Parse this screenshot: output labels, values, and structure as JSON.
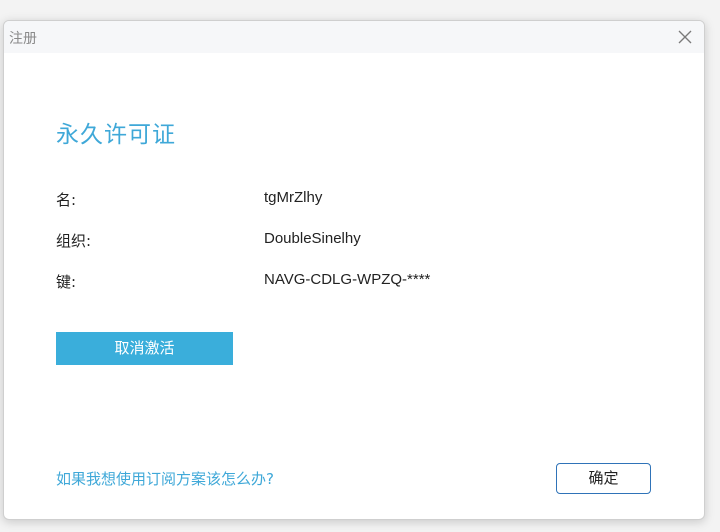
{
  "window": {
    "title": "注册",
    "close_icon": "close-icon"
  },
  "license": {
    "heading": "永久许可证",
    "fields": [
      {
        "label": "名:",
        "value": "tgMrZlhy"
      },
      {
        "label": "组织:",
        "value": "DoubleSinelhy"
      },
      {
        "label": "键:",
        "value": "NAVG-CDLG-WPZQ-****"
      }
    ],
    "deactivate_label": "取消激活"
  },
  "footer": {
    "help_link": "如果我想使用订阅方案该怎么办?",
    "ok_label": "确定"
  },
  "colors": {
    "accent": "#3fa8d8",
    "button_fill": "#3aaedb",
    "ok_border": "#2f73b8"
  }
}
